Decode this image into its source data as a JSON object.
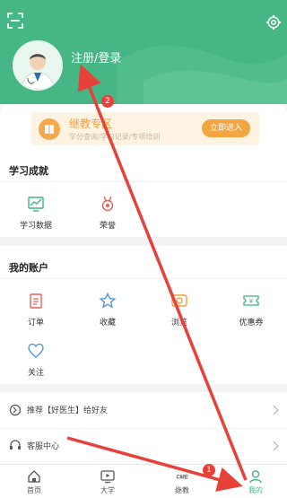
{
  "header": {
    "login_label": "注册/登录"
  },
  "banner": {
    "title": "继教专区",
    "subtitle": "学分查询/学习记录/专项培训",
    "button_label": "立即进入"
  },
  "study": {
    "title": "学习成就",
    "items": [
      {
        "label": "学习数据",
        "icon": "chart-icon"
      },
      {
        "label": "荣誉",
        "icon": "medal-icon"
      }
    ]
  },
  "account": {
    "title": "我的账户",
    "items": [
      {
        "label": "订单",
        "icon": "order-icon"
      },
      {
        "label": "收藏",
        "icon": "star-icon"
      },
      {
        "label": "浏览",
        "icon": "eye-icon"
      },
      {
        "label": "优惠券",
        "icon": "coupon-icon"
      },
      {
        "label": "关注",
        "icon": "heart-icon"
      }
    ]
  },
  "list": {
    "recommend": "推荐【好医生】给好友",
    "service": "客服中心"
  },
  "tabs": [
    {
      "label": "首页",
      "icon": "home-icon"
    },
    {
      "label": "大学",
      "icon": "video-icon"
    },
    {
      "label": "继教",
      "icon": "cme-icon"
    },
    {
      "label": "",
      "icon": "blank"
    },
    {
      "label": "我的",
      "icon": "person-icon",
      "active": true
    }
  ],
  "annotations": {
    "step1": "1",
    "step2": "2"
  },
  "colors": {
    "brand_green": "#45b684",
    "accent_orange": "#f2a541",
    "arrow_red": "#e8413a"
  }
}
